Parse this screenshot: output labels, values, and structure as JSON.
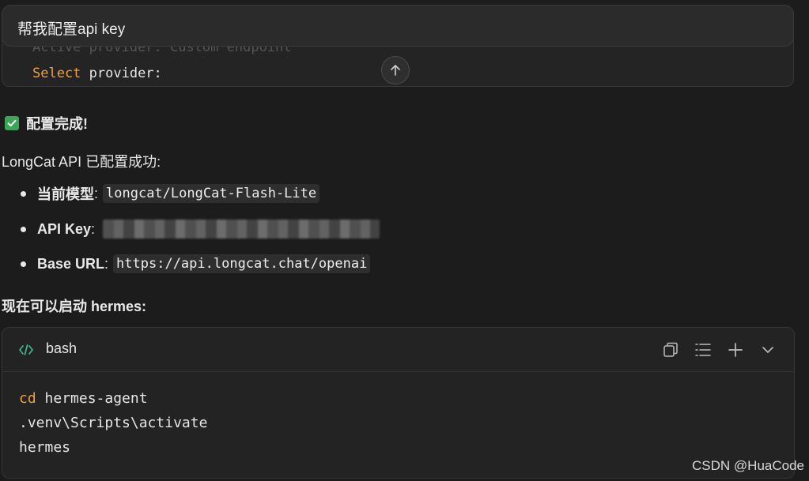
{
  "prompt": {
    "text": "帮我配置api key"
  },
  "terminal": {
    "faded_line": "Active provider:  Custom endpoint",
    "line_keyword": "Select",
    "line_rest": " provider:"
  },
  "reply": {
    "done_title": "配置完成!",
    "intro": "LongCat API 已配置成功:",
    "items": [
      {
        "label": "当前模型",
        "colon": ":",
        "value": "longcat/LongCat-Flash-Lite"
      },
      {
        "label": "API Key",
        "colon": ":",
        "value": ""
      },
      {
        "label": "Base URL",
        "colon": ":",
        "value": "https://api.longcat.chat/openai"
      }
    ],
    "start_hint": "现在可以启动 hermes:"
  },
  "code_block": {
    "language": "bash",
    "lines": [
      {
        "keyword": "cd",
        "rest": " hermes-agent"
      },
      {
        "keyword": "",
        "rest": ".venv\\Scripts\\activate"
      },
      {
        "keyword": "",
        "rest": "hermes"
      }
    ]
  },
  "watermark": "CSDN @HuaCode",
  "colors": {
    "background": "#1c1c1c",
    "keyword": "#f0a040",
    "check": "#3ea45a",
    "code_icon": "#3fbf8f"
  },
  "icons": [
    "arrow-up-icon",
    "check-icon",
    "code-icon",
    "copy-icon",
    "list-icon",
    "plus-icon",
    "chevron-down-icon"
  ]
}
